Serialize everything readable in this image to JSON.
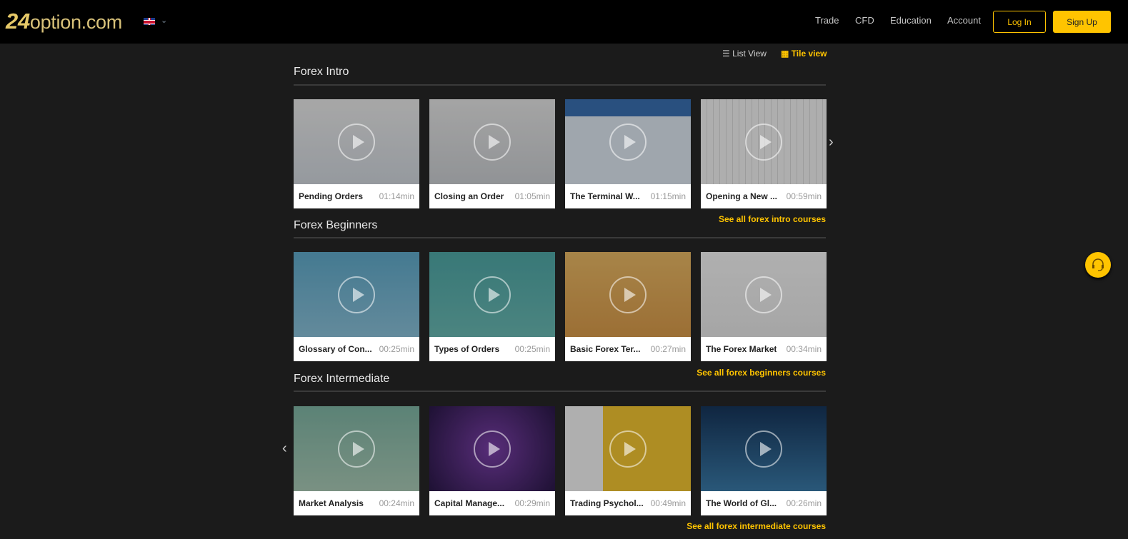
{
  "header": {
    "logo": "24option.com",
    "logo_num": "24",
    "logo_text": "option.com",
    "language": "English (UK)",
    "nav": [
      "Trade",
      "CFD",
      "Education",
      "Account"
    ],
    "login": "Log In",
    "signup": "Sign Up"
  },
  "view_toggle": {
    "list": "List View",
    "tile": "Tile view"
  },
  "sections": [
    {
      "title": "Forex Intro",
      "see_all": "See all forex intro courses",
      "cards": [
        {
          "title": "Pending Orders",
          "duration": "01:14min"
        },
        {
          "title": "Closing an Order",
          "duration": "01:05min"
        },
        {
          "title": "The Terminal W...",
          "duration": "01:15min"
        },
        {
          "title": "Opening a New ...",
          "duration": "00:59min"
        }
      ]
    },
    {
      "title": "Forex Beginners",
      "see_all": "See all forex beginners courses",
      "cards": [
        {
          "title": "Glossary of Con...",
          "duration": "00:25min"
        },
        {
          "title": "Types of Orders",
          "duration": "00:25min"
        },
        {
          "title": "Basic Forex Ter...",
          "duration": "00:27min"
        },
        {
          "title": "The Forex Market",
          "duration": "00:34min"
        }
      ]
    },
    {
      "title": "Forex Intermediate",
      "see_all": "See all forex intermediate courses",
      "cards": [
        {
          "title": "Market Analysis",
          "duration": "00:24min"
        },
        {
          "title": "Capital Manage...",
          "duration": "00:29min"
        },
        {
          "title": "Trading Psychol...",
          "duration": "00:49min"
        },
        {
          "title": "The World of Gl...",
          "duration": "00:26min"
        }
      ]
    }
  ],
  "colors": {
    "accent": "#ffc400",
    "bg": "#1b1b1b",
    "header": "#000000"
  }
}
